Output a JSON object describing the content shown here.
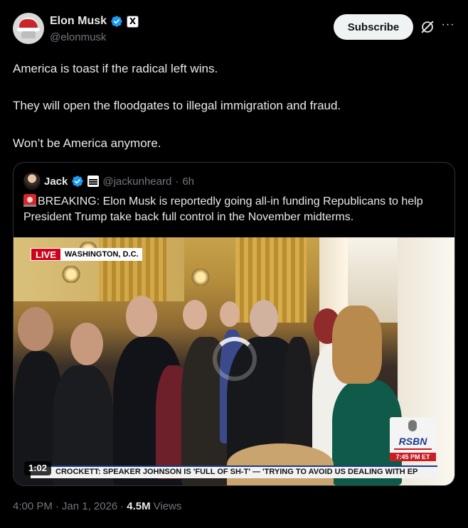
{
  "author": {
    "display_name": "Elon Musk",
    "handle": "@elonmusk",
    "affiliate_badge": "X"
  },
  "header": {
    "subscribe_label": "Subscribe",
    "more_label": "···"
  },
  "tweet": {
    "line1": "America is toast if the radical left wins.",
    "line2": "They will open the floodgates to illegal immigration and fraud.",
    "line3": "Won’t be America anymore."
  },
  "quote": {
    "display_name": "Jack",
    "handle": "@jackunheard",
    "separator": "·",
    "time": "6h",
    "text": "BREAKING: Elon Musk is reportedly going all-in funding Republicans to help President Trump take back full control in the November midterms."
  },
  "video": {
    "live_label": "LIVE",
    "dateline": "WASHINGTON, D.C.",
    "network_logo": "RSBN",
    "network_time": "7:45 PM ET",
    "ticker": "CROCKETT: SPEAKER JOHNSON IS 'FULL OF SH-T' — 'TRYING TO AVOID US DEALING WITH EP",
    "duration": "1:02"
  },
  "meta": {
    "time": "4:00 PM",
    "dot1": "·",
    "date": "Jan 1, 2026",
    "dot2": "·",
    "views_count": "4.5M",
    "views_label": "Views"
  },
  "colors": {
    "verified_blue": "#1d9bf0",
    "live_red": "#d0021b",
    "rsbn_blue": "#1e3b8a"
  }
}
